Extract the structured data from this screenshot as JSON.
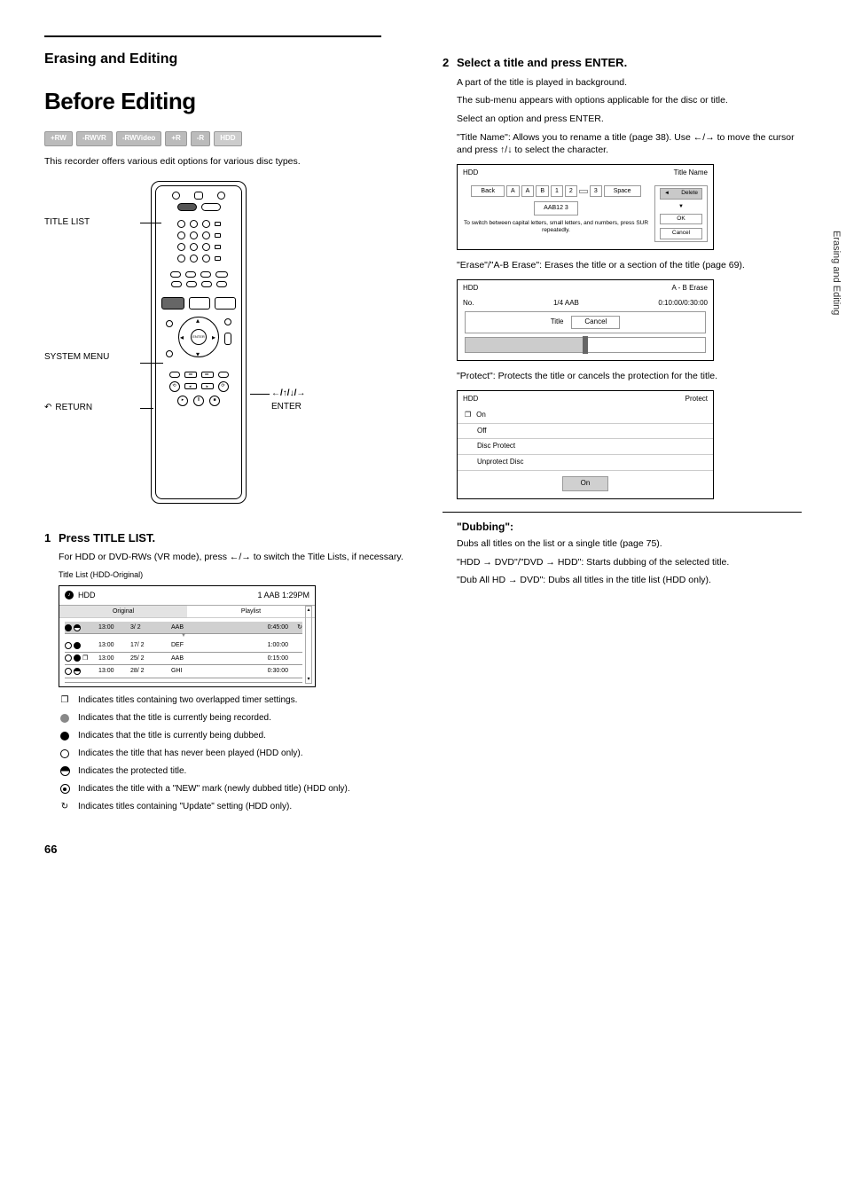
{
  "chapter": "Erasing and Editing",
  "title_main": "Before Editing",
  "disc_tags": [
    "+RW",
    "-RWVR",
    "-RWVideo",
    "+R",
    "-R",
    "HDD"
  ],
  "intro": "This recorder offers various edit options for various disc types.",
  "remote_labels": {
    "title_list": "TITLE LIST",
    "system_menu": "SYSTEM MENU",
    "return": "RETURN",
    "enter": "ENTER",
    "arrows": "←/↑/↓/→"
  },
  "step1": {
    "num": "1",
    "text": "Press TITLE LIST.",
    "after": "For HDD or DVD-RWs (VR mode), press ←/→ to switch the Title Lists, if necessary.",
    "caption": "Title List (HDD-Original)"
  },
  "title_list": {
    "header_left": "HDD",
    "header_right": "1 AAB   1:29PM",
    "tab1": "Original",
    "tab2": "Playlist",
    "rows": [
      {
        "icons": [
          "f",
          "h"
        ],
        "d": "13:00",
        "t": "3/ 2",
        "title": "AAB",
        "len": "0:45:00",
        "sel": true,
        "end": "update"
      },
      {
        "icons": [
          "o",
          "f"
        ],
        "d": "13:00",
        "t": "17/ 2",
        "title": "DEF",
        "len": "1:00:00"
      },
      {
        "icons": [
          "o",
          "f",
          "sq"
        ],
        "d": "13:00",
        "t": "25/ 2",
        "title": "AAB",
        "len": "0:15:00"
      },
      {
        "icons": [
          "o",
          "h"
        ],
        "d": "13:00",
        "t": "28/ 2",
        "title": "GHI",
        "len": "0:30:00"
      }
    ],
    "cursor_hint": "▼"
  },
  "legend": [
    {
      "icon": "overlap",
      "text": "Indicates titles containing two overlapped timer settings."
    },
    {
      "icon": "rec",
      "text": "Indicates that the title is currently being recorded."
    },
    {
      "icon": "dot",
      "text": "Indicates that the title is currently being dubbed."
    },
    {
      "icon": "circle",
      "text": "Indicates the title that has never been played (HDD only)."
    },
    {
      "icon": "half",
      "text": "Indicates the protected title."
    },
    {
      "icon": "new",
      "text": "Indicates the title with a \"NEW\" mark (newly dubbed title) (HDD only)."
    },
    {
      "icon": "update",
      "text": "Indicates titles containing \"Update\" setting (HDD only)."
    }
  ],
  "step2": {
    "num": "2",
    "text_a": "Select a title and press ENTER.",
    "text_b": "A part of the title is played in background.",
    "text_c": "The sub-menu appears with options applicable for the disc or title.",
    "text_d": "Select an option and press ENTER.",
    "options": {
      "title_name": {
        "label": "\"Title Name\":",
        "desc": "Allows you to rename a title (page 38). Use ←/→ to move the cursor and press ↑/↓ to select the character.",
        "fig": {
          "head_left": "HDD",
          "head_right": "Title Name",
          "buttons_left": "Back",
          "chars": [
            "A",
            "A",
            "B",
            "1",
            "2",
            " ",
            "3"
          ],
          "space": "Space",
          "del": "Delete",
          "hint": "To switch between capital letters, small letters, and numbers, press SUR repeatedly.",
          "preview": "AAB12 3",
          "right_panel_top_arrows": [
            "◄",
            "▼"
          ],
          "right_panel": [
            "OK",
            "Cancel"
          ]
        }
      },
      "erase": {
        "label": "\"Erase\"/\"A-B Erase\":",
        "desc": "Erases the title or a section of the title (page 69).",
        "fig": {
          "head_left": "HDD",
          "head_right": "A - B Erase",
          "info_row": [
            "No.",
            "1/4   AAB",
            "0:10:00/0:30:00"
          ],
          "track_label": "Title",
          "btn": "Cancel"
        }
      },
      "protect": {
        "label": "\"Protect\":",
        "desc": "Protects the title or cancels the protection for the title.",
        "fig": {
          "head_left": "HDD",
          "head_right": "Protect",
          "rows": [
            {
              "icon": "sq",
              "label": "On"
            },
            {
              "label": "Off"
            },
            {
              "label": "Disc Protect"
            },
            {
              "label": "Unprotect Disc"
            }
          ],
          "selected": "On"
        }
      }
    }
  },
  "dubbing": {
    "heading": "\"Dubbing\":",
    "para1": "Dubs all titles on the list or a single title (page 75).",
    "para2": "\"HDD → DVD\"/\"DVD → HDD\": Starts dubbing of the selected title.",
    "para3": "\"Dub All HD → DVD\": Dubs all titles in the title list (HDD only)."
  },
  "page_number": "66",
  "side_tab": "Erasing and Editing"
}
